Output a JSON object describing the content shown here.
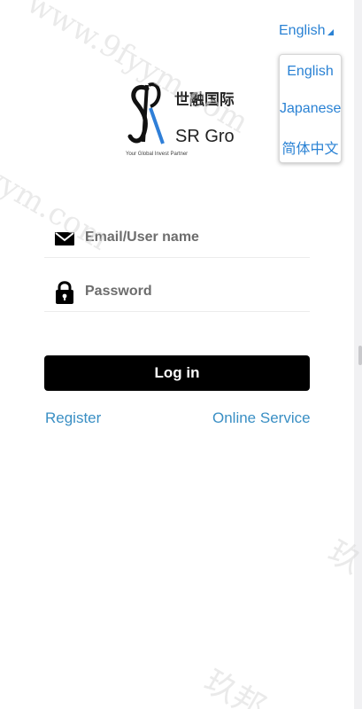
{
  "language": {
    "current": "English",
    "options": [
      "English",
      "Japanese",
      "简体中文"
    ]
  },
  "logo": {
    "chinese_name": "世融国际",
    "english_name": "SR Group",
    "tagline": "Your Global Invest Partner"
  },
  "form": {
    "email_placeholder": "Email/User name",
    "password_placeholder": "Password",
    "login_label": "Log in",
    "register_label": "Register",
    "online_service_label": "Online Service"
  },
  "watermark": {
    "text_top": "www.9fyym.com",
    "text_left": "fyym.com",
    "text_bottom": "玖邦",
    "text_right": "玖"
  },
  "colors": {
    "link_blue": "#2a82d4",
    "button_black": "#000000",
    "logo_blue": "#2f7fd8"
  }
}
